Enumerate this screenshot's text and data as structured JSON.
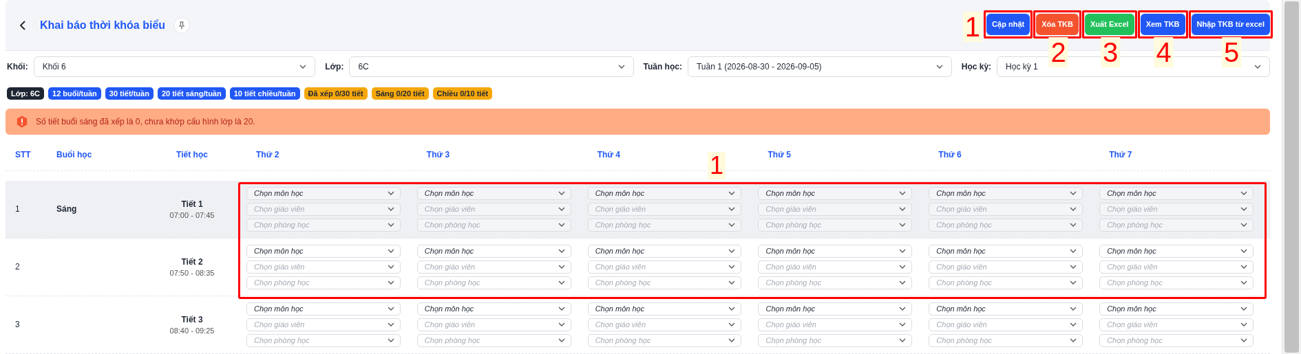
{
  "header": {
    "title": "Khai báo thời khóa biểu",
    "buttons": [
      {
        "label": "Cập nhật",
        "color": "#2158f5",
        "annotation": "1"
      },
      {
        "label": "Xóa TKB",
        "color": "#f4532e",
        "annotation": "2"
      },
      {
        "label": "Xuất Excel",
        "color": "#22c05a",
        "annotation": "3"
      },
      {
        "label": "Xem TKB",
        "color": "#2158f5",
        "annotation": "4"
      },
      {
        "label": "Nhập TKB từ excel",
        "color": "#2158f5",
        "annotation": "5"
      }
    ]
  },
  "filters": [
    {
      "label": "Khối:",
      "value": "Khối 6"
    },
    {
      "label": "Lớp:",
      "value": "6C"
    },
    {
      "label": "Tuần học:",
      "value": "Tuần 1 (2026-08-30 - 2026-09-05)"
    },
    {
      "label": "Học kỳ:",
      "value": "Học kỳ 1"
    }
  ],
  "badges": [
    {
      "text": "Lớp: 6C",
      "color": "#1f2633"
    },
    {
      "text": "12 buổi/tuần",
      "color": "#2158f5"
    },
    {
      "text": "30 tiết/tuần",
      "color": "#2158f5"
    },
    {
      "text": "20 tiết sáng/tuần",
      "color": "#2158f5"
    },
    {
      "text": "10 tiết chiều/tuần",
      "color": "#2158f5"
    },
    {
      "text": "Đã xếp 0/30 tiết",
      "color": "#f5a80c"
    },
    {
      "text": "Sáng 0/20 tiết",
      "color": "#f5a80c"
    },
    {
      "text": "Chiều 0/10 tiết",
      "color": "#f5a80c"
    }
  ],
  "alert": {
    "text": "Số tiết buổi sáng đã xếp là 0, chưa khớp cấu hình lớp là 20."
  },
  "table": {
    "columns": [
      "STT",
      "Buổi học",
      "Tiết học",
      "Thứ 2",
      "Thứ 3",
      "Thứ 4",
      "Thứ 5",
      "Thứ 6",
      "Thứ 7"
    ],
    "annotation": "1",
    "rows": [
      {
        "highlighted": true,
        "cells": [
          {
            "text": "1"
          },
          {
            "text": "Sáng"
          },
          {
            "text": "Tiết 1",
            "time": "07:00 - 07:45"
          },
          {
            "subject": "Chọn môn học",
            "teacher": "Chọn giáo viên",
            "room": "Chọn phòng học"
          },
          {
            "subject": "Chọn môn học",
            "teacher": "Chọn giáo viên",
            "room": "Chọn phòng học"
          },
          {
            "subject": "Chọn môn học",
            "teacher": "Chọn giáo viên",
            "room": "Chọn phòng học"
          },
          {
            "subject": "Chọn môn học",
            "teacher": "Chọn giáo viên",
            "room": "Chọn phòng học"
          },
          {
            "subject": "Chọn môn học",
            "teacher": "Chọn giáo viên",
            "room": "Chọn phòng học"
          },
          {
            "subject": "Chọn môn học",
            "teacher": "Chọn giáo viên",
            "room": "Chọn phòng học"
          }
        ]
      },
      {
        "highlighted": false,
        "cells": [
          {
            "text": "2"
          },
          {
            "text": ""
          },
          {
            "text": "Tiết 2",
            "time": "07:50 - 08:35"
          },
          {
            "subject": "Chọn môn học",
            "teacher": "Chọn giáo viên",
            "room": "Chọn phòng học"
          },
          {
            "subject": "Chọn môn học",
            "teacher": "Chọn giáo viên",
            "room": "Chọn phòng học"
          },
          {
            "subject": "Chọn môn học",
            "teacher": "Chọn giáo viên",
            "room": "Chọn phòng học"
          },
          {
            "subject": "Chọn môn học",
            "teacher": "Chọn giáo viên",
            "room": "Chọn phòng học"
          },
          {
            "subject": "Chọn môn học",
            "teacher": "Chọn giáo viên",
            "room": "Chọn phòng học"
          },
          {
            "subject": "Chọn môn học",
            "teacher": "Chọn giáo viên",
            "room": "Chọn phòng học"
          }
        ]
      },
      {
        "highlighted": false,
        "cells": [
          {
            "text": "3"
          },
          {
            "text": ""
          },
          {
            "text": "Tiết 3",
            "time": "08:40 - 09:25"
          },
          {
            "subject": "Chọn môn học",
            "teacher": "Chọn giáo viên",
            "room": "Chọn phòng học"
          },
          {
            "subject": "Chọn môn học",
            "teacher": "Chọn giáo viên",
            "room": "Chọn phòng học"
          },
          {
            "subject": "Chọn môn học",
            "teacher": "Chọn giáo viên",
            "room": "Chọn phòng học"
          },
          {
            "subject": "Chọn môn học",
            "teacher": "Chọn giáo viên",
            "room": "Chọn phòng học"
          },
          {
            "subject": "Chọn môn học",
            "teacher": "Chọn giáo viên",
            "room": "Chọn phòng học"
          },
          {
            "subject": "Chọn môn học",
            "teacher": "Chọn giáo viên",
            "room": "Chọn phòng học"
          }
        ]
      }
    ]
  }
}
